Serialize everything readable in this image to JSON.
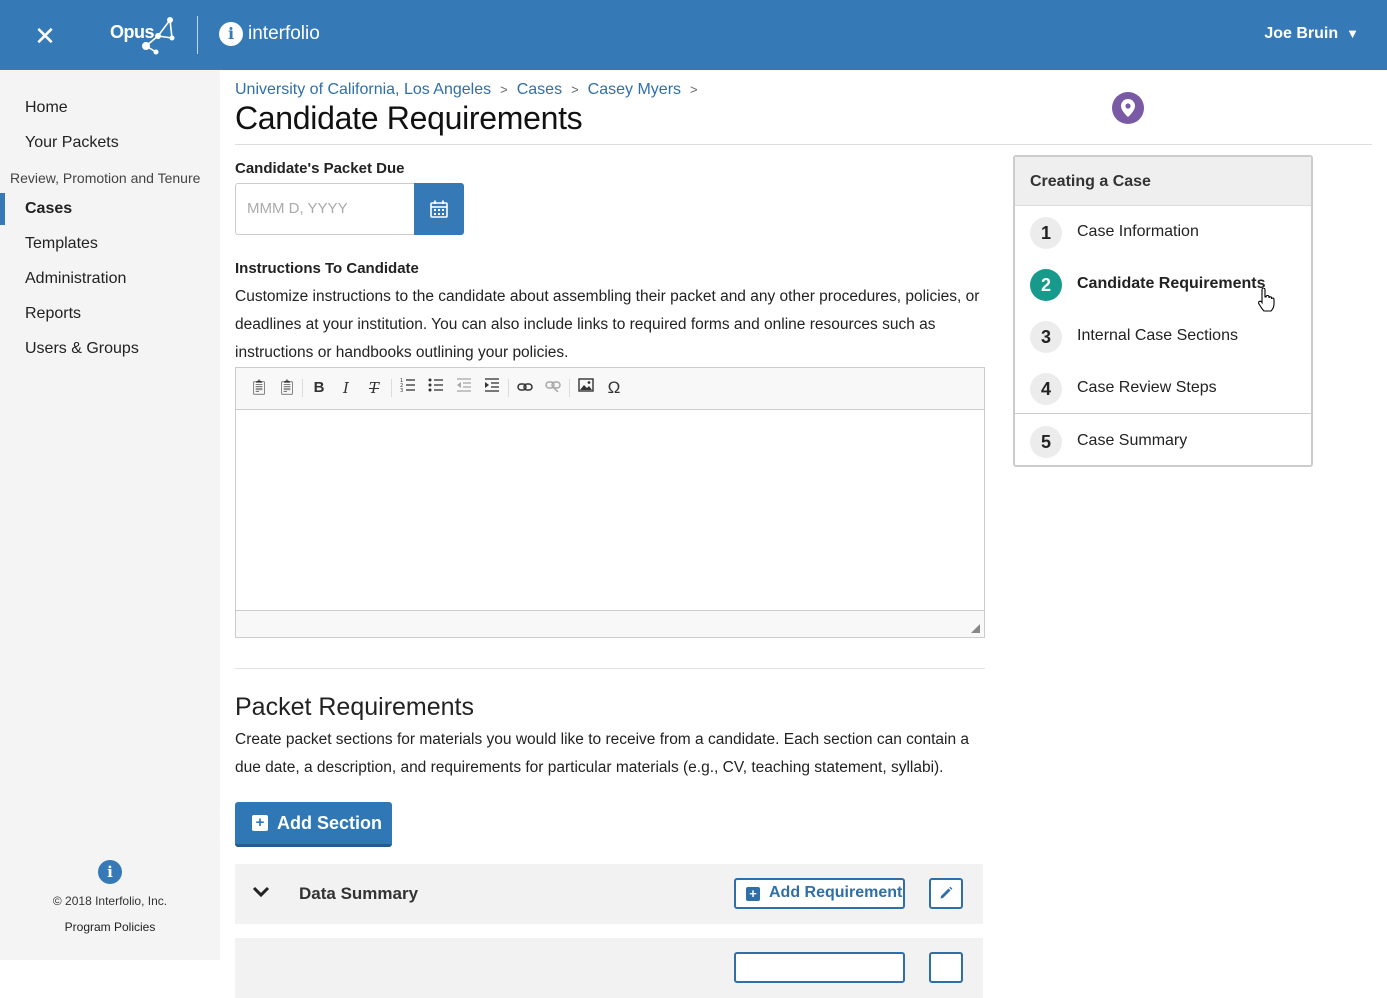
{
  "header": {
    "opus_label": "Opus",
    "interfolio_label": "interfolio",
    "user_name": "Joe Bruin",
    "colors": {
      "bar": "#357ab7"
    }
  },
  "sidebar": {
    "items": [
      {
        "label": "Home"
      },
      {
        "label": "Your Packets"
      }
    ],
    "group_label": "Review, Promotion and Tenure",
    "group_items": [
      {
        "label": "Cases",
        "active": true
      },
      {
        "label": "Templates"
      },
      {
        "label": "Administration"
      },
      {
        "label": "Reports"
      },
      {
        "label": "Users & Groups"
      }
    ],
    "copyright": "© 2018 Interfolio, Inc.",
    "policies_label": "Program Policies"
  },
  "breadcrumb": [
    "University of California, Los Angeles",
    "Cases",
    "Casey Myers"
  ],
  "page_title": "Candidate Requirements",
  "packet_due": {
    "label": "Candidate's Packet Due",
    "placeholder": "MMM D, YYYY"
  },
  "instructions": {
    "label": "Instructions To Candidate",
    "text": "Customize instructions to the candidate about assembling their packet and any other procedures, policies, or deadlines at your institution. You can also include links to required forms and online resources such as instructions or handbooks outlining your policies.",
    "toolbar_glyphs": {
      "bold": "B",
      "italic": "I",
      "remove_format": "T",
      "special_char": "Ω"
    }
  },
  "packet_requirements": {
    "title": "Packet Requirements",
    "description": "Create packet sections for materials you would like to receive from a candidate. Each section can contain a due date, a description, and requirements for particular materials (e.g., CV, teaching statement, syllabi).",
    "add_section_label": "Add Section",
    "sections": [
      {
        "name": "Data Summary",
        "add_requirement_label": "Add Requirement"
      },
      {
        "name": "",
        "add_requirement_label": ""
      }
    ]
  },
  "steps_panel": {
    "title": "Creating a Case",
    "steps": [
      {
        "number": "1",
        "label": "Case Information"
      },
      {
        "number": "2",
        "label": "Candidate Requirements",
        "current": true
      },
      {
        "number": "3",
        "label": "Internal Case Sections"
      },
      {
        "number": "4",
        "label": "Case Review Steps"
      },
      {
        "number": "5",
        "label": "Case Summary"
      }
    ],
    "colors": {
      "current": "#17998b"
    }
  }
}
